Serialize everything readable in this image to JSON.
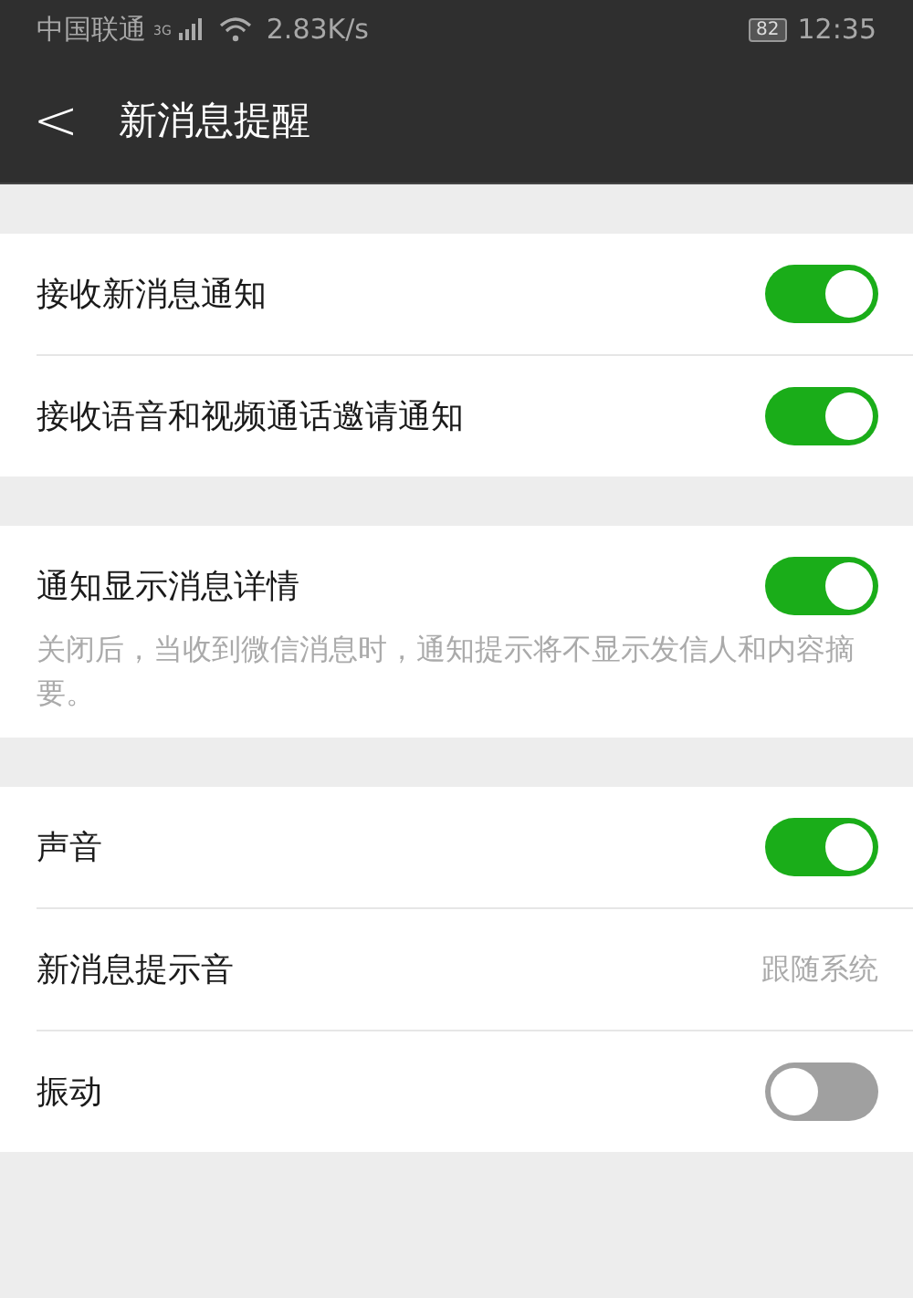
{
  "status_bar": {
    "carrier": "中国联通",
    "network": "3G",
    "speed": "2.83K/s",
    "battery": "82",
    "time": "12:35"
  },
  "header": {
    "back": "<",
    "title": "新消息提醒"
  },
  "sections": [
    {
      "items": [
        {
          "kind": "toggle",
          "label": "接收新消息通知",
          "on": true
        },
        {
          "kind": "toggle",
          "label": "接收语音和视频通话邀请通知",
          "on": true
        }
      ]
    },
    {
      "items": [
        {
          "kind": "toggle",
          "label": "通知显示消息详情",
          "on": true
        }
      ],
      "note": "关闭后，当收到微信消息时，通知提示将不显示发信人和内容摘要。"
    },
    {
      "items": [
        {
          "kind": "toggle",
          "label": "声音",
          "on": true
        },
        {
          "kind": "value",
          "label": "新消息提示音",
          "value": "跟随系统"
        },
        {
          "kind": "toggle",
          "label": "振动",
          "on": false
        }
      ]
    }
  ]
}
